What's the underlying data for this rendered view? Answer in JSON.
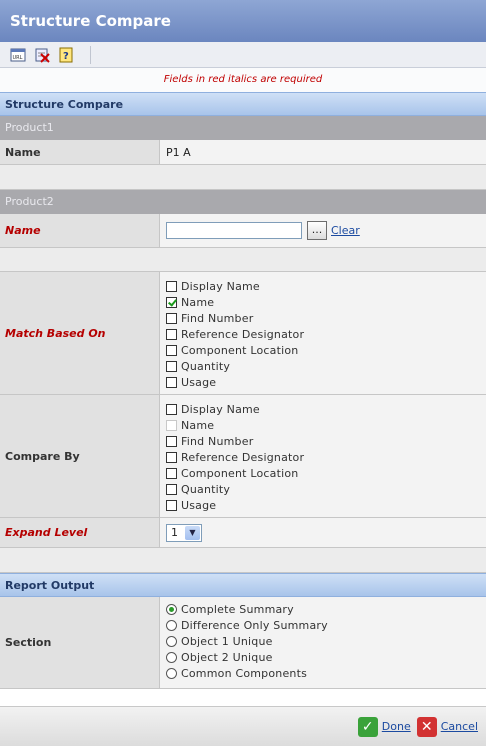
{
  "window": {
    "title": "Structure Compare"
  },
  "toolbar": {
    "icons": [
      "url-icon",
      "clear-fields-icon",
      "help-icon"
    ]
  },
  "required_note": "Fields in red italics are required",
  "sections": {
    "main_title": "Structure Compare",
    "product1_title": "Product1",
    "product2_title": "Product2",
    "report_title": "Report Output"
  },
  "product1": {
    "name_label": "Name",
    "name_value": "P1 A"
  },
  "product2": {
    "name_label": "Name",
    "name_value": "",
    "browse_label": "...",
    "clear_label": "Clear"
  },
  "match_based_on": {
    "label": "Match Based On",
    "options": [
      {
        "label": "Display Name",
        "checked": false
      },
      {
        "label": "Name",
        "checked": true
      },
      {
        "label": "Find Number",
        "checked": false
      },
      {
        "label": "Reference Designator",
        "checked": false
      },
      {
        "label": "Component Location",
        "checked": false
      },
      {
        "label": "Quantity",
        "checked": false
      },
      {
        "label": "Usage",
        "checked": false
      }
    ]
  },
  "compare_by": {
    "label": "Compare By",
    "options": [
      {
        "label": "Display Name",
        "checked": false
      },
      {
        "label": "Name",
        "checked": false,
        "disabled": true
      },
      {
        "label": "Find Number",
        "checked": false
      },
      {
        "label": "Reference Designator",
        "checked": false
      },
      {
        "label": "Component Location",
        "checked": false
      },
      {
        "label": "Quantity",
        "checked": false
      },
      {
        "label": "Usage",
        "checked": false
      }
    ]
  },
  "expand_level": {
    "label": "Expand Level",
    "value": "1"
  },
  "section": {
    "label": "Section",
    "options": [
      {
        "label": "Complete Summary",
        "selected": true
      },
      {
        "label": "Difference Only Summary",
        "selected": false
      },
      {
        "label": "Object 1 Unique",
        "selected": false
      },
      {
        "label": "Object 2 Unique",
        "selected": false
      },
      {
        "label": "Common Components",
        "selected": false
      }
    ]
  },
  "footer": {
    "done_label": "Done",
    "cancel_label": "Cancel"
  },
  "colors": {
    "required": "#b50000",
    "link": "#1b4aa0",
    "title_bar": "#6b86bf"
  }
}
